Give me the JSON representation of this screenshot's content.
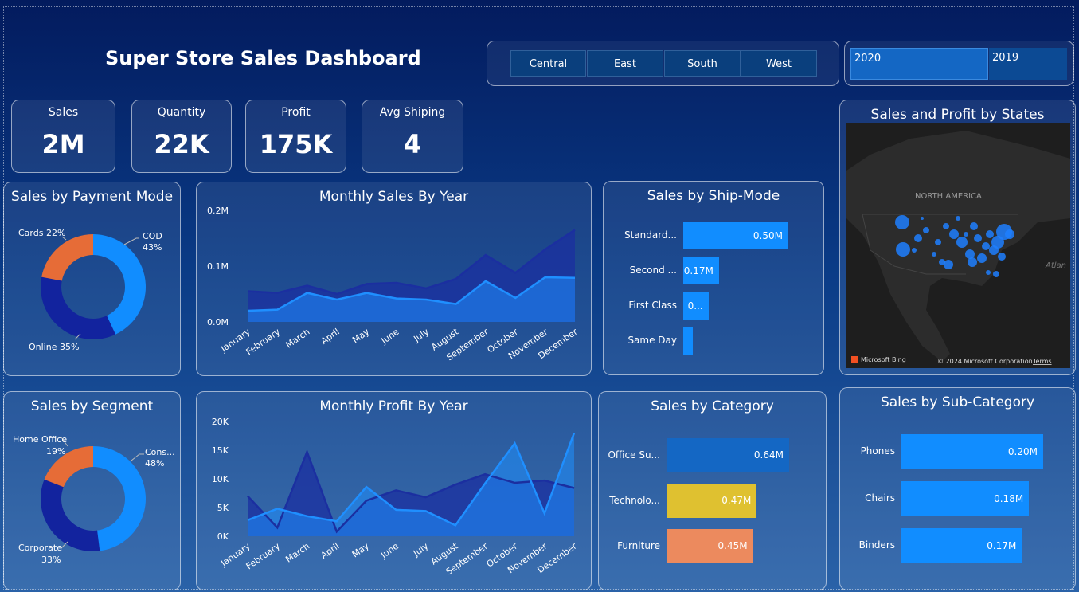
{
  "header": {
    "title": "Super Store Sales Dashboard"
  },
  "regions": [
    "Central",
    "East",
    "South",
    "West"
  ],
  "years": [
    "2020",
    "2019"
  ],
  "kpis": [
    {
      "label": "Sales",
      "value": "2M"
    },
    {
      "label": "Quantity",
      "value": "22K"
    },
    {
      "label": "Profit",
      "value": "175K"
    },
    {
      "label": "Avg Shiping",
      "value": "4"
    }
  ],
  "payment": {
    "title": "Sales by Payment Mode",
    "slices": [
      {
        "name": "COD",
        "pct_label": "43%",
        "value": 43,
        "color": "#118dff"
      },
      {
        "name": "Online",
        "pct_label": "Online 35%",
        "value": 35,
        "color": "#12239e"
      },
      {
        "name": "Cards",
        "pct_label": "Cards 22%",
        "value": 22,
        "color": "#e66c37"
      }
    ]
  },
  "segment": {
    "title": "Sales by Segment",
    "slices": [
      {
        "name": "Cons...",
        "pct_label": "48%",
        "value": 48,
        "color": "#118dff"
      },
      {
        "name": "Corporate",
        "pct_label": "33%",
        "value": 33,
        "color": "#12239e"
      },
      {
        "name": "Home Office",
        "pct_label": "19%",
        "value": 19,
        "color": "#e66c37"
      }
    ]
  },
  "monthly_sales": {
    "title": "Monthly Sales By Year"
  },
  "monthly_profit": {
    "title": "Monthly Profit By Year"
  },
  "ship_mode": {
    "title": "Sales by Ship-Mode",
    "bars": [
      {
        "label": "Standard...",
        "value": 0.5,
        "text": "0.50M"
      },
      {
        "label": "Second ...",
        "value": 0.17,
        "text": "0.17M"
      },
      {
        "label": "First Class",
        "value": 0.12,
        "text": "0..."
      },
      {
        "label": "Same Day",
        "value": 0.04,
        "text": ""
      }
    ],
    "color": "#118dff"
  },
  "category": {
    "title": "Sales by Category",
    "bars": [
      {
        "label": "Office Su...",
        "value": 0.64,
        "text": "0.64M",
        "color": "#1467c4"
      },
      {
        "label": "Technolo...",
        "value": 0.47,
        "text": "0.47M",
        "color": "#dfc130"
      },
      {
        "label": "Furniture",
        "value": 0.45,
        "text": "0.45M",
        "color": "#ec8a5e"
      }
    ]
  },
  "subcategory": {
    "title": "Sales by Sub-Category",
    "bars": [
      {
        "label": "Phones",
        "value": 0.2,
        "text": "0.20M"
      },
      {
        "label": "Chairs",
        "value": 0.18,
        "text": "0.18M"
      },
      {
        "label": "Binders",
        "value": 0.17,
        "text": "0.17M"
      }
    ],
    "color": "#118dff"
  },
  "map": {
    "title": "Sales and Profit by States",
    "region_label": "NORTH AMERICA",
    "ocean_label": "Atlan",
    "brand": "Microsoft Bing",
    "copyright": "© 2024 Microsoft Corporation",
    "terms": "Terms"
  },
  "chart_data": [
    {
      "type": "area",
      "title": "Monthly Sales By Year",
      "categories": [
        "January",
        "February",
        "March",
        "April",
        "May",
        "June",
        "July",
        "August",
        "September",
        "October",
        "November",
        "December"
      ],
      "ylim": [
        0,
        0.2
      ],
      "yticks": [
        "0.0M",
        "0.1M",
        "0.2M"
      ],
      "series": [
        {
          "color": "#1b2fa0",
          "values": [
            0.055,
            0.052,
            0.065,
            0.05,
            0.068,
            0.07,
            0.06,
            0.077,
            0.12,
            0.088,
            0.13,
            0.165
          ]
        },
        {
          "color": "#1f8fff",
          "values": [
            0.02,
            0.022,
            0.052,
            0.04,
            0.052,
            0.042,
            0.04,
            0.032,
            0.073,
            0.043,
            0.08,
            0.079
          ]
        }
      ]
    },
    {
      "type": "area",
      "title": "Monthly Profit By Year",
      "categories": [
        "January",
        "February",
        "March",
        "April",
        "May",
        "June",
        "July",
        "August",
        "September",
        "October",
        "November",
        "December"
      ],
      "ylim": [
        0,
        20000
      ],
      "yticks": [
        "0K",
        "5K",
        "10K",
        "15K",
        "20K"
      ],
      "series": [
        {
          "color": "#1b2fa0",
          "values": [
            7000,
            1500,
            14700,
            800,
            6200,
            8000,
            6800,
            9000,
            10800,
            9300,
            9700,
            8400
          ]
        },
        {
          "color": "#1f8fff",
          "values": [
            2800,
            4800,
            3500,
            2600,
            8600,
            4600,
            4400,
            1900,
            9200,
            16200,
            4000,
            18000
          ]
        }
      ]
    }
  ]
}
